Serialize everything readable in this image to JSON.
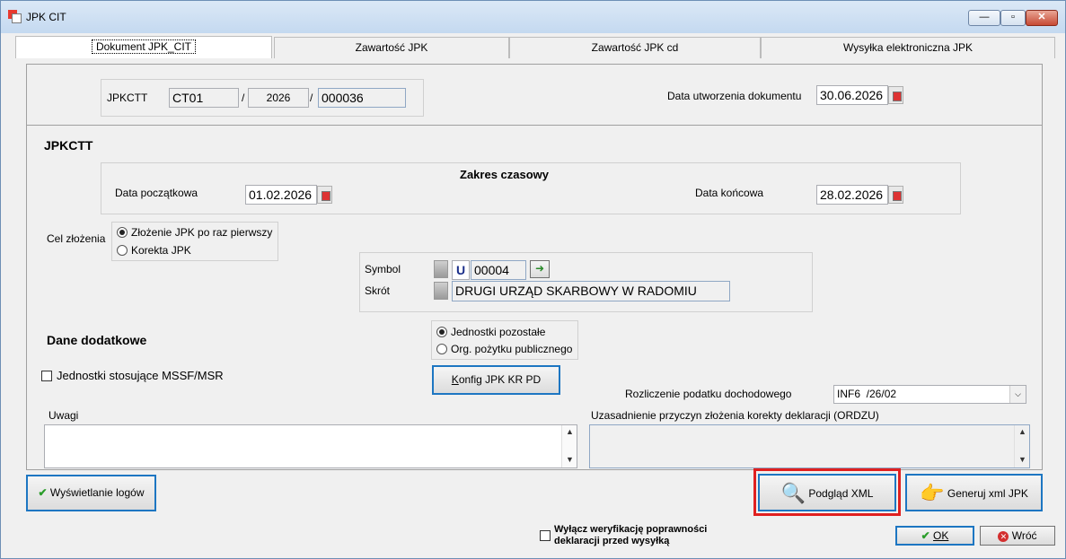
{
  "window": {
    "title": "JPK CIT",
    "minimize_label": "—",
    "maximize_label": "▫",
    "close_label": "✕"
  },
  "tabs": [
    {
      "label": "Dokument JPK_CIT",
      "active": true
    },
    {
      "label": "Zawartość JPK",
      "active": false
    },
    {
      "label": "Zawartość JPK cd",
      "active": false
    },
    {
      "label": "Wysyłka elektroniczna JPK",
      "active": false
    }
  ],
  "header": {
    "doc_label": "JPKCTT",
    "doc_prefix": "CT01",
    "slash1": "/",
    "doc_year": "2026",
    "slash2": "/",
    "doc_number": "000036",
    "created_label": "Data utworzenia dokumentu",
    "created_date": "30.06.2026"
  },
  "section": {
    "title": "JPKCTT",
    "range_title": "Zakres czasowy",
    "start_label": "Data początkowa",
    "start_date": "01.02.2026",
    "end_label": "Data końcowa",
    "end_date": "28.02.2026"
  },
  "purpose": {
    "label": "Cel złożenia",
    "options": [
      "Złożenie JPK po raz pierwszy",
      "Korekta JPK"
    ],
    "selected": "Złożenie JPK po raz pierwszy"
  },
  "office": {
    "symbol_label": "Symbol",
    "symbol_u": "U",
    "symbol_value": "00004",
    "short_label": "Skrót",
    "short_value": "DRUGI URZĄD SKARBOWY W RADOMIU"
  },
  "additional": {
    "title": "Dane dodatkowe",
    "msr_label": "Jednostki stosujące MSSF/MSR",
    "unit_options": [
      "Jednostki pozostałe",
      "Org. pożytku publicznego"
    ],
    "unit_selected": "Jednostki pozostałe",
    "config_button": "Konfig JPK KR PD",
    "tax_label": "Rozliczenie podatku dochodowego",
    "tax_value": "INF6  /26/02"
  },
  "notes": {
    "uwagi_label": "Uwagi",
    "ordzu_label": "Uzasadnienie przyczyn złożenia korekty deklaracji (ORDZU)"
  },
  "actions": {
    "logs_button": "Wyświetlanie logów",
    "preview_button": "Podgląd XML",
    "generate_button": "Generuj xml JPK",
    "skip_verify_line1": "Wyłącz weryfikację poprawności",
    "skip_verify_line2": "deklaracji przed wysyłką",
    "ok_button": "OK",
    "back_button": "Wróć"
  },
  "colors": {
    "highlight_red": "#e02020",
    "focus_blue": "#1d76c2",
    "ok_check": "#2a9d2a"
  }
}
